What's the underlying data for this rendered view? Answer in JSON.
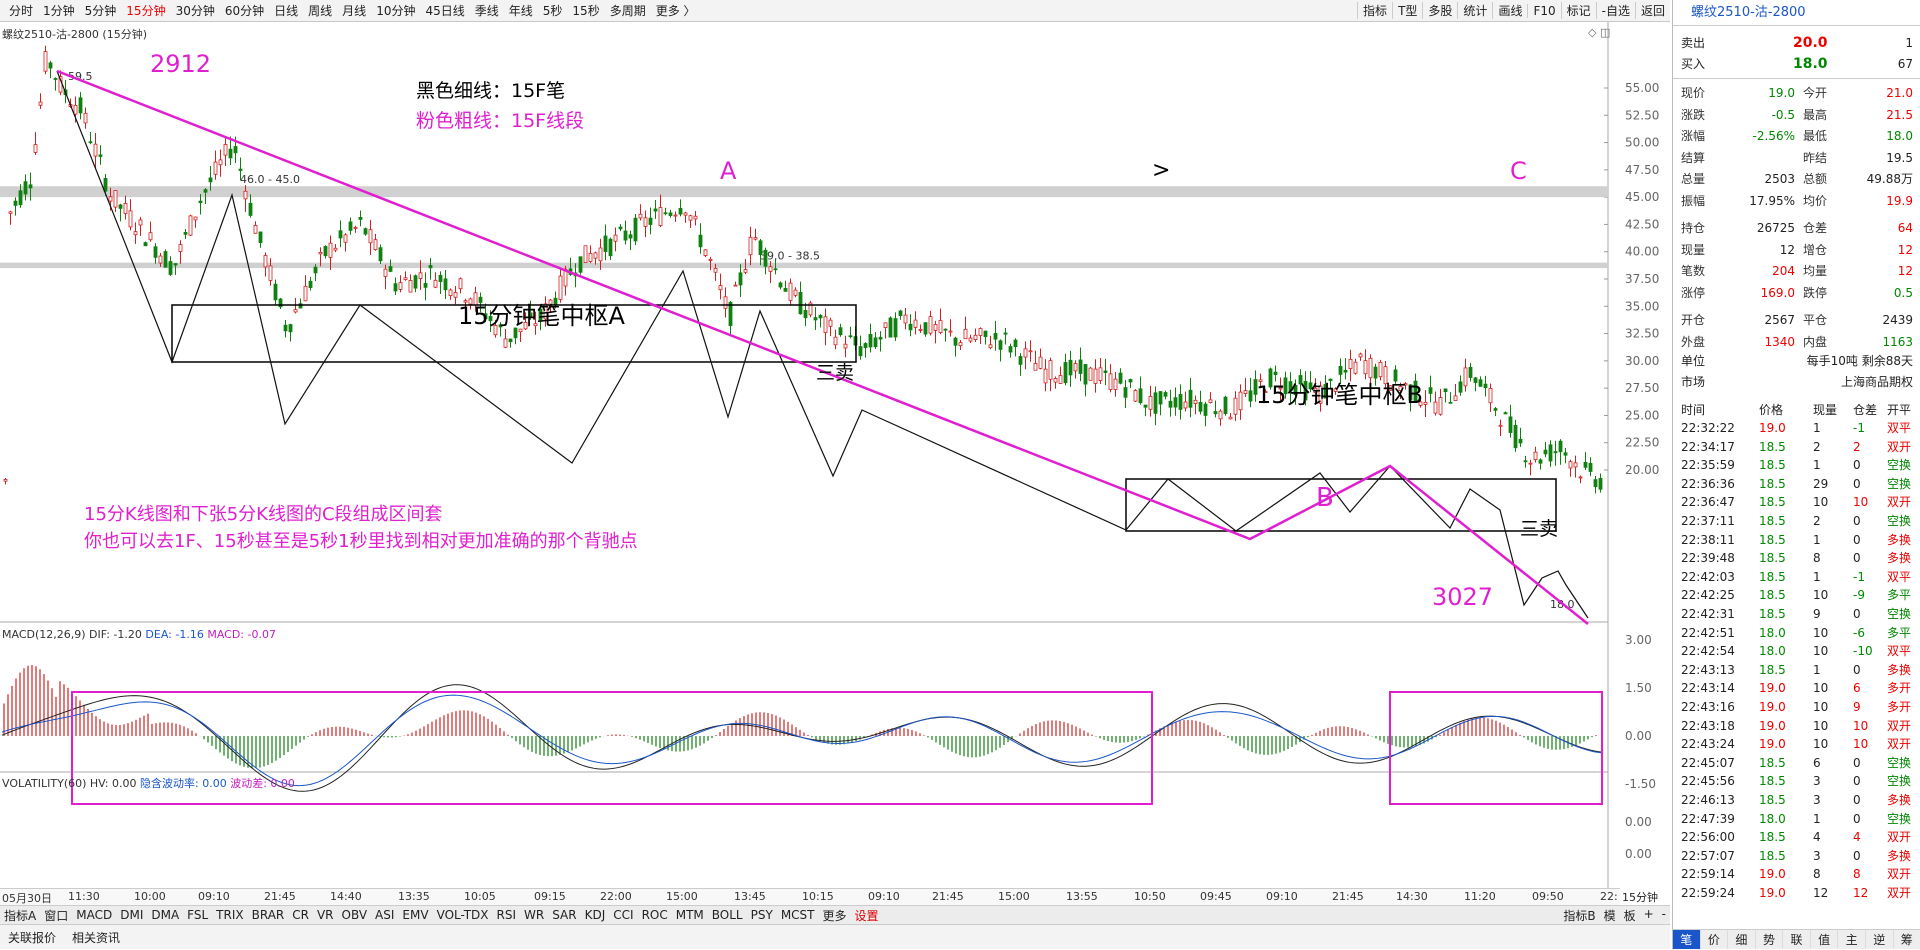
{
  "toolbar": {
    "periods": [
      "分时",
      "1分钟",
      "5分钟",
      "15分钟",
      "30分钟",
      "60分钟",
      "日线",
      "周线",
      "月线",
      "10分钟",
      "45日线",
      "季线",
      "年线",
      "5秒",
      "15秒",
      "多周期",
      "更多 〉"
    ],
    "active_period": "15分钟",
    "right_tools": [
      "指标",
      "T型",
      "多股",
      "统计",
      "画线",
      "F10",
      "标记",
      "-自选",
      "返回"
    ]
  },
  "chart": {
    "title": "螺纹2510-沽-2800 (15分钟)",
    "high_label": "59.5",
    "low_label": "18.0",
    "zone1_label": "46.0 - 45.0",
    "zone2_label": "39.0 - 38.5",
    "y_ticks": [
      "55.00",
      "52.50",
      "50.00",
      "47.50",
      "45.00",
      "42.50",
      "40.00",
      "37.50",
      "35.00",
      "32.50",
      "30.00",
      "27.50",
      "25.00",
      "22.50",
      "20.00"
    ],
    "y_tick_values": [
      55,
      52.5,
      50,
      47.5,
      45,
      42.5,
      40,
      37.5,
      35,
      32.5,
      30,
      27.5,
      25,
      22.5,
      20
    ],
    "annotations": {
      "n2912": "2912",
      "black_line": "黑色细线：15F笔",
      "pink_line": "粉色粗线：15F线段",
      "A": "A",
      "arrow": ">",
      "C": "C",
      "zhongshu_a": "15分钟笔中枢A",
      "sanmai1": "三卖",
      "zhongshu_b": "15分钟笔中枢B",
      "B": "B",
      "sanmai2": "三卖",
      "n3027": "3027",
      "note1": "15分K线图和下张5分K线图的C段组成区间套",
      "note2": "你也可以去1F、15秒甚至是5秒1秒里找到相对更加准确的那个背驰点"
    },
    "colors": {
      "pink": "#e020d0",
      "up": "#d02020",
      "down": "#108010",
      "zone": "#d0d0d0"
    }
  },
  "macd": {
    "head_name": "MACD(12,26,9)",
    "dif": "DIF: -1.20",
    "dea": "DEA: -1.16",
    "macd": "MACD: -0.07",
    "y_ticks": [
      "3.00",
      "1.50",
      "0.00",
      "-1.50"
    ],
    "y_tick_values": [
      3,
      1.5,
      0,
      -1.5
    ]
  },
  "volatility": {
    "head_name": "VOLATILITY(60)",
    "hv": "HV: 0.00",
    "implied": "隐含波动率: 0.00",
    "diff": "波动差: 0.00",
    "y_ticks": [
      "0.00",
      "0.00"
    ]
  },
  "time_axis": {
    "labels": [
      "05月30日",
      "11:30",
      "10:00",
      "09:10",
      "21:45",
      "14:40",
      "13:35",
      "10:05",
      "09:15",
      "22:00",
      "15:00",
      "13:45",
      "10:15",
      "09:10",
      "21:45",
      "15:00",
      "13:55",
      "10:50",
      "09:45",
      "09:10",
      "21:45",
      "14:30",
      "11:20",
      "09:50",
      "22:"
    ],
    "period": "15分钟"
  },
  "indicator_tabs": [
    "指标A",
    "窗口",
    "MACD",
    "DMI",
    "DMA",
    "FSL",
    "TRIX",
    "BRAR",
    "CR",
    "VR",
    "OBV",
    "ASI",
    "EMV",
    "VOL-TDX",
    "RSI",
    "WR",
    "SAR",
    "KDJ",
    "CCI",
    "ROC",
    "MTM",
    "BOLL",
    "PSY",
    "MCST",
    "更多",
    "设置"
  ],
  "indicator_right": [
    "指标B",
    "模",
    "板",
    "+",
    "-"
  ],
  "bottom_tabs": [
    "关联报价",
    "相关资讯"
  ],
  "side": {
    "title": "螺纹2510-沽-2800",
    "sell": {
      "label": "卖出",
      "price": "20.0",
      "qty": "1"
    },
    "buy": {
      "label": "买入",
      "price": "18.0",
      "qty": "67"
    },
    "rows": [
      [
        "现价",
        "19.0",
        "今开",
        "21.0"
      ],
      [
        "涨跌",
        "-0.5",
        "最高",
        "21.5"
      ],
      [
        "涨幅",
        "-2.56%",
        "最低",
        "18.0"
      ],
      [
        "结算",
        "",
        "昨结",
        "19.5"
      ],
      [
        "总量",
        "2503",
        "总额",
        "49.88万"
      ],
      [
        "振幅",
        "17.95%",
        "均价",
        "19.9"
      ],
      [
        "持仓",
        "26725",
        "仓差",
        "64"
      ],
      [
        "现量",
        "12",
        "增仓",
        "12"
      ],
      [
        "笔数",
        "204",
        "均量",
        "12"
      ],
      [
        "涨停",
        "169.0",
        "跌停",
        "0.5"
      ],
      [
        "开仓",
        "2567",
        "平仓",
        "2439"
      ],
      [
        "外盘",
        "1340",
        "内盘",
        "1163"
      ]
    ],
    "unit_label": "单位",
    "unit_value": "每手10吨  剩余88天",
    "market_label": "市场",
    "market_value": "上海商品期权",
    "trade_header": [
      "时间",
      "价格",
      "现量",
      "仓差",
      "开平"
    ],
    "trades": [
      [
        "22:32:22",
        "19.0",
        "1",
        "-1",
        "双平"
      ],
      [
        "22:34:17",
        "18.5",
        "2",
        "2",
        "双开"
      ],
      [
        "22:35:59",
        "18.5",
        "1",
        "0",
        "空换"
      ],
      [
        "22:36:36",
        "18.5",
        "29",
        "0",
        "空换"
      ],
      [
        "22:36:47",
        "18.5",
        "10",
        "10",
        "双开"
      ],
      [
        "22:37:11",
        "18.5",
        "2",
        "0",
        "空换"
      ],
      [
        "22:38:11",
        "18.5",
        "1",
        "0",
        "多换"
      ],
      [
        "22:39:48",
        "18.5",
        "8",
        "0",
        "多换"
      ],
      [
        "22:42:03",
        "18.5",
        "1",
        "-1",
        "双平"
      ],
      [
        "22:42:25",
        "18.5",
        "10",
        "-9",
        "多平"
      ],
      [
        "22:42:31",
        "18.5",
        "9",
        "0",
        "空换"
      ],
      [
        "22:42:51",
        "18.0",
        "10",
        "-6",
        "多平"
      ],
      [
        "22:42:54",
        "18.0",
        "10",
        "-10",
        "双平"
      ],
      [
        "22:43:13",
        "18.5",
        "1",
        "0",
        "多换"
      ],
      [
        "22:43:14",
        "19.0",
        "10",
        "6",
        "多开"
      ],
      [
        "22:43:16",
        "19.0",
        "10",
        "9",
        "多开"
      ],
      [
        "22:43:18",
        "19.0",
        "10",
        "10",
        "双开"
      ],
      [
        "22:43:24",
        "19.0",
        "10",
        "10",
        "双开"
      ],
      [
        "22:45:07",
        "18.5",
        "6",
        "0",
        "空换"
      ],
      [
        "22:45:56",
        "18.5",
        "3",
        "0",
        "空换"
      ],
      [
        "22:46:13",
        "18.5",
        "3",
        "0",
        "多换"
      ],
      [
        "22:47:39",
        "18.0",
        "1",
        "0",
        "空换"
      ],
      [
        "22:56:00",
        "18.5",
        "4",
        "4",
        "双开"
      ],
      [
        "22:57:07",
        "18.5",
        "3",
        "0",
        "多换"
      ],
      [
        "22:59:14",
        "19.0",
        "8",
        "8",
        "双开"
      ],
      [
        "22:59:24",
        "19.0",
        "12",
        "12",
        "双开"
      ]
    ],
    "bottom_tabs": [
      "笔",
      "价",
      "细",
      "势",
      "联",
      "值",
      "主",
      "逆",
      "筹"
    ]
  }
}
